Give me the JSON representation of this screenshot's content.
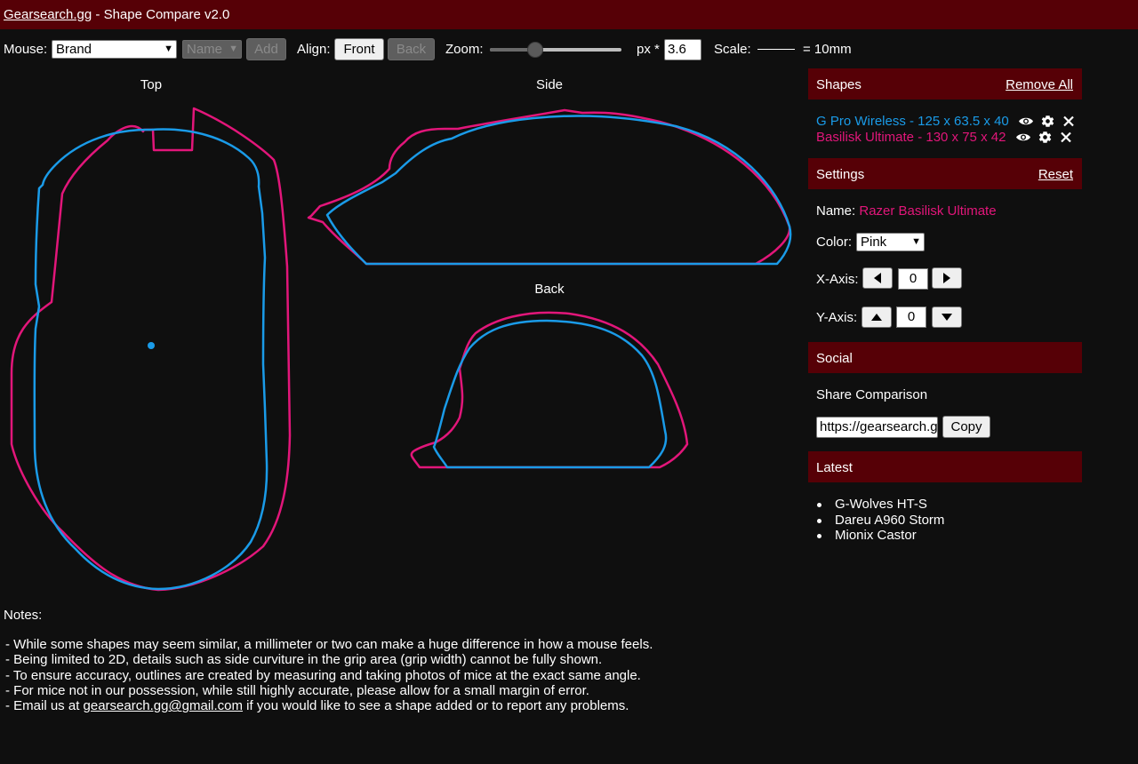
{
  "header": {
    "site_link": "Gearsearch.gg",
    "title_rest": " - Shape Compare v2.0"
  },
  "toolbar": {
    "mouse_label": "Mouse:",
    "brand_select": "Brand",
    "name_select": "Name",
    "add_button": "Add",
    "align_label": "Align:",
    "front_button": "Front",
    "back_button": "Back",
    "zoom_label": "Zoom:",
    "zoom_level": 0.32,
    "px_label": "px *",
    "px_value": "3.6",
    "scale_label": "Scale:",
    "scale_value": "= 10mm"
  },
  "views": {
    "top": "Top",
    "side": "Side",
    "back": "Back"
  },
  "colors": {
    "blue": "#1a9be8",
    "pink": "#e2167a",
    "header": "#560006",
    "background": "#0f0f0f"
  },
  "shapes_panel": {
    "title": "Shapes",
    "remove_all": "Remove All",
    "items": [
      {
        "label": "G Pro Wireless - 125 x 63.5 x 40",
        "color": "#1a9be8"
      },
      {
        "label": "Basilisk Ultimate - 130 x 75 x 42",
        "color": "#e2167a"
      }
    ],
    "icons": [
      "eye-icon",
      "gear-icon",
      "close-icon"
    ]
  },
  "settings": {
    "title": "Settings",
    "reset": "Reset",
    "name_label": "Name:",
    "name_value": "Razer Basilisk Ultimate",
    "color_label": "Color:",
    "color_value": "Pink",
    "x_label": "X-Axis:",
    "x_value": "0",
    "y_label": "Y-Axis:",
    "y_value": "0"
  },
  "social": {
    "title": "Social",
    "share_label": "Share Comparison",
    "share_url": "https://gearsearch.gg/shape-compare",
    "copy_button": "Copy"
  },
  "latest": {
    "title": "Latest",
    "items": [
      "G-Wolves HT-S",
      "Dareu A960 Storm",
      "Mionix Castor"
    ]
  },
  "notes": {
    "title": "Notes:",
    "lines": [
      "- While some shapes may seem similar, a millimeter or two can make a huge difference in how a mouse feels.",
      "- Being limited to 2D, details such as side curviture in the grip area (grip width) cannot be fully shown.",
      "- To ensure accuracy, outlines are created by measuring and taking photos of mice at the exact same angle.",
      "- For mice not in our possession, while still highly accurate, please allow for a small margin of error."
    ],
    "email_prefix": "- Email us at ",
    "email": "gearsearch.gg@gmail.com",
    "email_suffix": " if you would like to see a shape added or to report any problems."
  }
}
